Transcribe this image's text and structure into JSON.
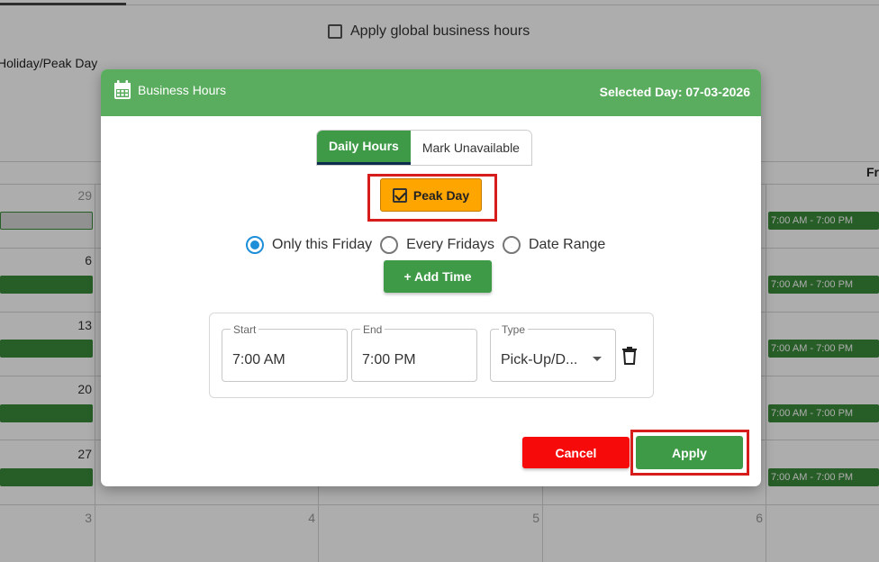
{
  "background": {
    "global_hours_label": "Apply global business hours",
    "legend_text": "Holiday/Peak Day",
    "header_partial_day": "Fr",
    "left_day_numbers": [
      "29",
      "6",
      "13",
      "20",
      "27"
    ],
    "bottom_day_numbers": [
      "3",
      "4",
      "5",
      "6"
    ],
    "right_hours": [
      "7:00 AM - 7:00 PM",
      "7:00 AM - 7:00 PM",
      "7:00 AM - 7:00 PM",
      "7:00 AM - 7:00 PM",
      "7:00 AM - 7:00 PM"
    ]
  },
  "modal": {
    "title": "Business Hours",
    "selected_day": "Selected Day: 07-03-2026",
    "tabs": [
      {
        "label": "Daily Hours",
        "active": true
      },
      {
        "label": "Mark Unavailable",
        "active": false
      }
    ],
    "peak_day": {
      "label": "Peak Day",
      "checked": true
    },
    "apply_options": [
      {
        "label": "Only this Friday",
        "selected": true
      },
      {
        "label": "Every Fridays",
        "selected": false
      },
      {
        "label": "Date Range",
        "selected": false
      }
    ],
    "add_time_label": "+ Add Time",
    "time_slot": {
      "start_label": "Start",
      "start_value": "7:00 AM",
      "end_label": "End",
      "end_value": "7:00 PM",
      "type_label": "Type",
      "type_value": "Pick-Up/D..."
    },
    "cancel_label": "Cancel",
    "apply_label": "Apply"
  },
  "colors": {
    "header_green": "#5aad5e",
    "button_green": "#3f9a47",
    "peak_orange": "#ffa500",
    "cancel_red": "#f70a0a",
    "highlight_red": "#d71c1c",
    "radio_blue": "#1e8ed8"
  },
  "icons": [
    "calendar-icon",
    "checkbox-checked-icon",
    "dropdown-caret-icon",
    "trash-icon"
  ]
}
